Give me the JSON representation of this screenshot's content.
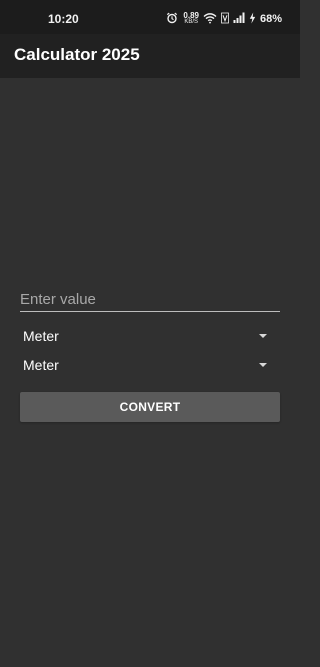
{
  "status_bar": {
    "time": "10:20",
    "network_speed_value": "0.89",
    "network_speed_unit": "KB/S",
    "battery_percent": "68%",
    "icons": [
      "alarm-icon",
      "wifi-icon",
      "volte-icon",
      "signal-icon",
      "charging-icon"
    ]
  },
  "app_bar": {
    "title": "Calculator 2025"
  },
  "converter": {
    "input_placeholder": "Enter value",
    "input_value": "",
    "from_unit": "Meter",
    "to_unit": "Meter",
    "convert_label": "CONVERT"
  }
}
